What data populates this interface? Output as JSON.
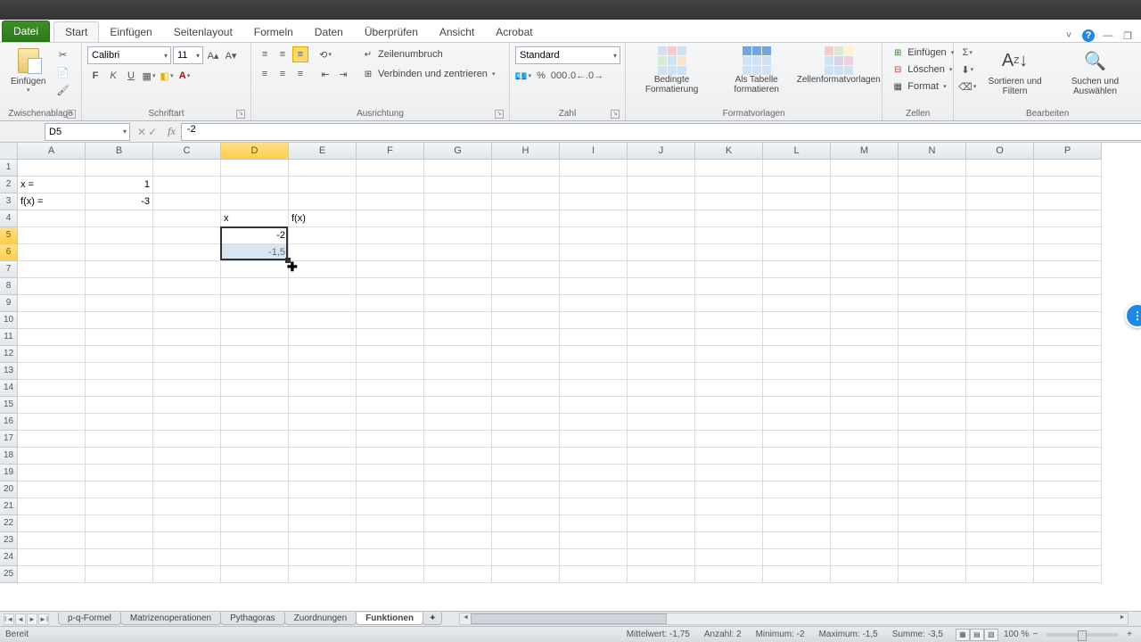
{
  "tabs": {
    "file": "Datei",
    "items": [
      "Start",
      "Einfügen",
      "Seitenlayout",
      "Formeln",
      "Daten",
      "Überprüfen",
      "Ansicht",
      "Acrobat"
    ],
    "active": "Start"
  },
  "ribbon": {
    "clipboard": {
      "paste": "Einfügen",
      "label": "Zwischenablage"
    },
    "font": {
      "name": "Calibri",
      "size": "11",
      "label": "Schriftart"
    },
    "alignment": {
      "wrap": "Zeilenumbruch",
      "merge": "Verbinden und zentrieren",
      "label": "Ausrichtung"
    },
    "number": {
      "format": "Standard",
      "label": "Zahl"
    },
    "styles": {
      "cond": "Bedingte Formatierung",
      "table": "Als Tabelle formatieren",
      "cell": "Zellenformatvorlagen",
      "label": "Formatvorlagen"
    },
    "cells": {
      "insert": "Einfügen",
      "delete": "Löschen",
      "format": "Format",
      "label": "Zellen"
    },
    "editing": {
      "sort": "Sortieren und Filtern",
      "find": "Suchen und Auswählen",
      "label": "Bearbeiten"
    }
  },
  "formula_bar": {
    "name_box": "D5",
    "formula": "-2"
  },
  "columns": [
    "A",
    "B",
    "C",
    "D",
    "E",
    "F",
    "G",
    "H",
    "I",
    "J",
    "K",
    "L",
    "M",
    "N",
    "O",
    "P"
  ],
  "selected_col": "D",
  "selected_rows": [
    5,
    6
  ],
  "row_count": 25,
  "cells": {
    "A2": "x =",
    "B2": "1",
    "A3": "f(x) =",
    "B3": "-3",
    "D4": "x",
    "E4": "f(x)",
    "D5": "-2",
    "D6": "-1,5"
  },
  "sheet_tabs": [
    "p-q-Formel",
    "Matrizenoperationen",
    "Pythagoras",
    "Zuordnungen",
    "Funktionen"
  ],
  "active_sheet": "Funktionen",
  "status": {
    "ready": "Bereit",
    "avg": "Mittelwert: -1,75",
    "count": "Anzahl: 2",
    "min": "Minimum: -2",
    "max": "Maximum: -1,5",
    "sum": "Summe: -3,5",
    "zoom": "100 %"
  }
}
